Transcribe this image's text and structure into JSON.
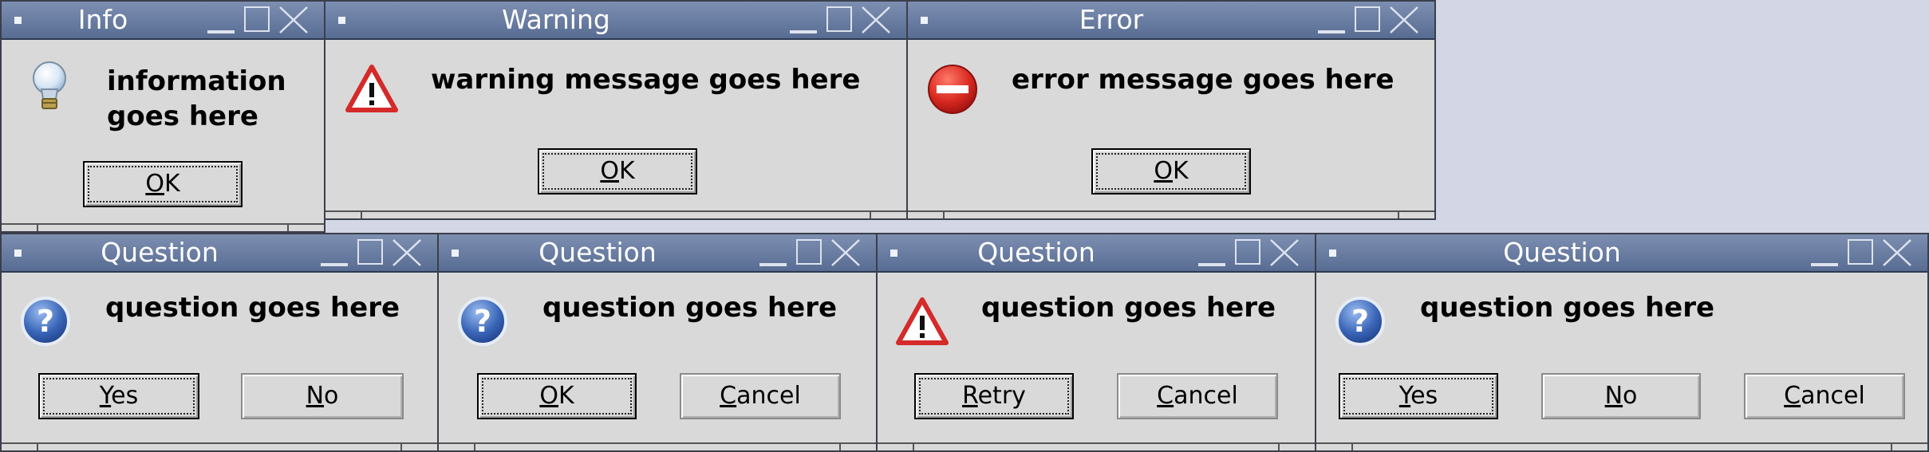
{
  "dialogs": {
    "info": {
      "title": "Info",
      "icon": "lightbulb-icon",
      "message_line1": "information",
      "message_line2": "goes here",
      "ok": {
        "key": "O",
        "rest": "K"
      }
    },
    "warning": {
      "title": "Warning",
      "icon": "warning-triangle-icon",
      "message": "warning message goes here",
      "ok": {
        "key": "O",
        "rest": "K"
      }
    },
    "error": {
      "title": "Error",
      "icon": "error-stop-icon",
      "message": "error message goes here",
      "ok": {
        "key": "O",
        "rest": "K"
      }
    },
    "question_yes_no": {
      "title": "Question",
      "icon": "question-icon",
      "message": "question goes here",
      "yes": {
        "key": "Y",
        "rest": "es"
      },
      "no": {
        "key": "N",
        "rest": "o"
      }
    },
    "question_ok_cancel": {
      "title": "Question",
      "icon": "question-icon",
      "message": "question goes here",
      "ok": {
        "key": "O",
        "rest": "K"
      },
      "cancel": {
        "key": "C",
        "rest": "ancel"
      }
    },
    "question_retry_cancel": {
      "title": "Question",
      "icon": "warning-triangle-icon",
      "message": "question goes here",
      "retry": {
        "key": "R",
        "rest": "etry"
      },
      "cancel": {
        "key": "C",
        "rest": "ancel"
      }
    },
    "question_yes_no_cancel": {
      "title": "Question",
      "icon": "question-icon",
      "message": "question goes here",
      "yes": {
        "key": "Y",
        "rest": "es"
      },
      "no": {
        "key": "N",
        "rest": "o"
      },
      "cancel": {
        "key": "C",
        "rest": "ancel"
      }
    }
  },
  "colors": {
    "desktop": "#d3d6e4",
    "titlebar": "#6a7ea3",
    "dialog_bg": "#d9d9d9",
    "warning_red": "#d42a2a",
    "question_blue": "#3a66b8"
  }
}
